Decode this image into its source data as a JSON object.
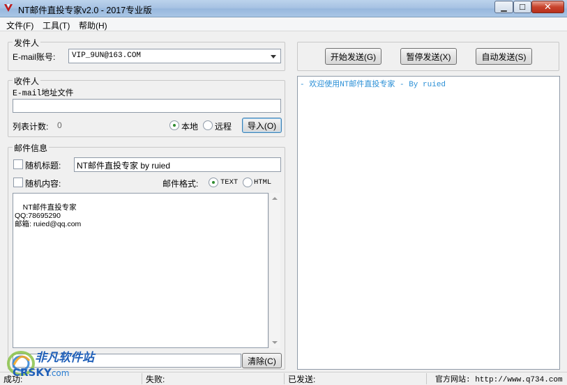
{
  "window": {
    "title": "NT邮件直投专家v2.0 - 2017专业版",
    "min_glyph": "▁",
    "max_glyph": "☐",
    "close_glyph": "✕"
  },
  "menu": [
    "文件(F)",
    "工具(T)",
    "帮助(H)"
  ],
  "sender": {
    "group_title": "发件人",
    "email_label": "E-mail账号:",
    "email_value": "VIP_9UN@163.COM"
  },
  "recipient": {
    "group_title": "收件人",
    "file_label": "E-mail地址文件",
    "file_value": "",
    "count_label": "列表计数:",
    "count_value": "0",
    "local_label": "本地",
    "remote_label": "远程",
    "import_label": "导入(O)"
  },
  "mail": {
    "group_title": "邮件信息",
    "random_subject_label": "随机标题:",
    "subject_value": "NT邮件直投专家 by ruied",
    "random_content_label": "随机内容:",
    "format_label": "邮件格式:",
    "format_text": "TEXT",
    "format_html": "HTML",
    "body_text": "NT邮件直投专家\nQQ:78695290\n邮箱: ruied@qq.com",
    "clear_label": "清除(C)"
  },
  "actions": {
    "start_label": "开始发送(G)",
    "pause_label": "暂停发送(X)",
    "auto_label": "自动发送(S)"
  },
  "log": {
    "line": "- 欢迎使用NT邮件直投专家 - By ruied"
  },
  "status": {
    "success": "成功:",
    "fail": "失败:",
    "sent": "已发送:",
    "site": "官方网站: http://www.q734.com"
  },
  "watermark": {
    "text_cn": "非凡软件站",
    "text_en": "CRSKY",
    "suffix": ".com"
  },
  "colors": {
    "log_text": "#2a8fd6",
    "radio_dot": "#2e8b2e",
    "watermark_blue": "#1f5fb8"
  }
}
